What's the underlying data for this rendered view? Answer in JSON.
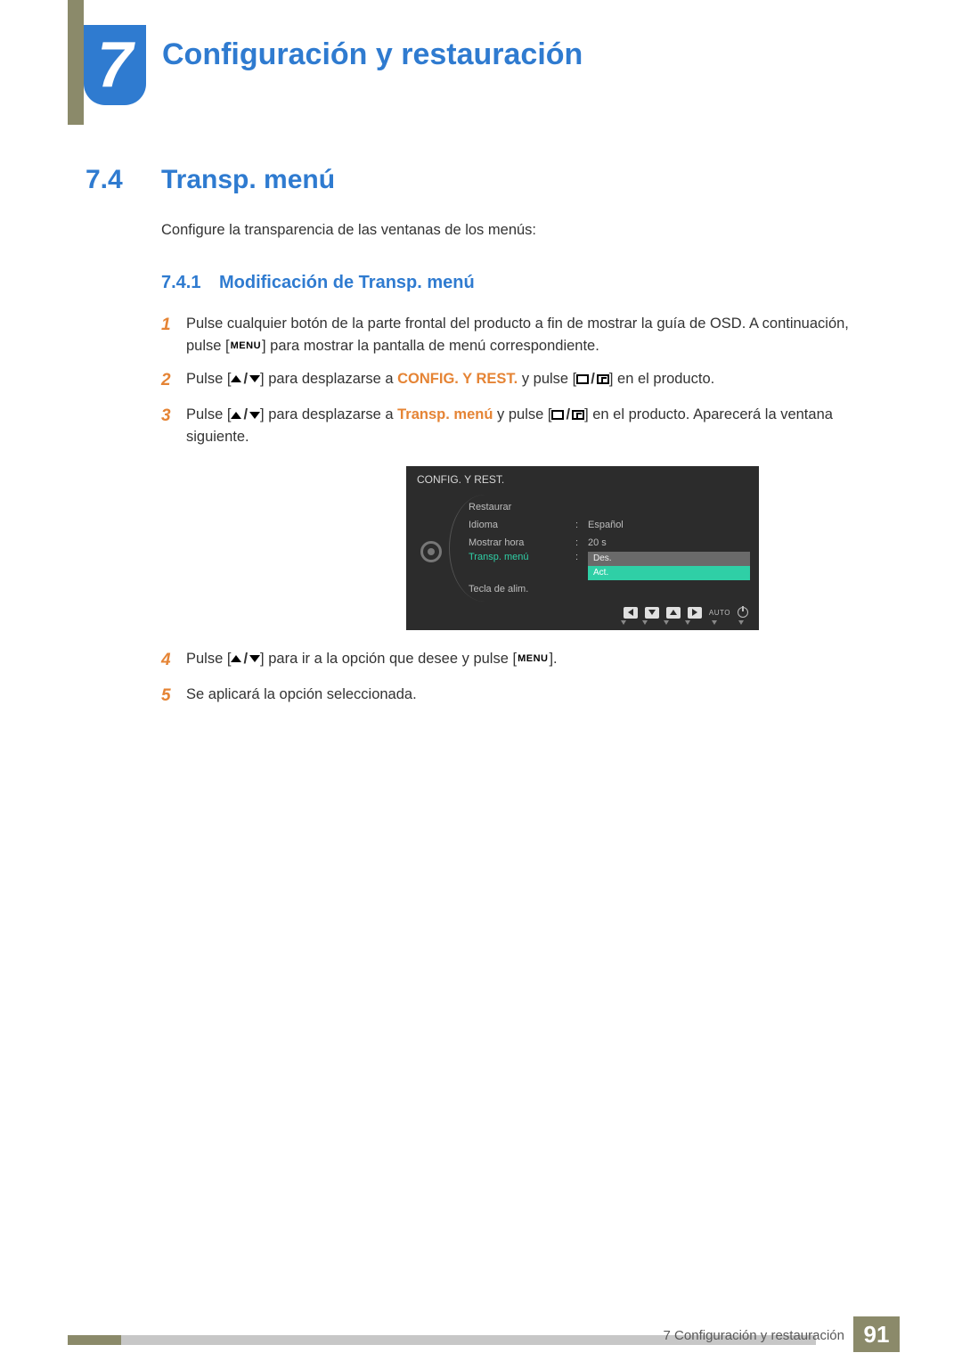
{
  "chapter": {
    "number": "7",
    "title": "Configuración y restauración"
  },
  "section": {
    "number": "7.4",
    "title": "Transp. menú"
  },
  "intro": "Configure la transparencia de las ventanas de los menús:",
  "subsection": {
    "number": "7.4.1",
    "title": "Modificación de Transp. menú"
  },
  "steps": {
    "s1": {
      "n": "1",
      "a": "Pulse cualquier botón de la parte frontal del producto a fin de mostrar la guía de OSD. A continuación, pulse [",
      "menu": "MENU",
      "b": "] para mostrar la pantalla de menú correspondiente."
    },
    "s2": {
      "n": "2",
      "a": "Pulse [",
      "b": "] para desplazarse a ",
      "strong": "CONFIG. Y REST.",
      "c": " y pulse [",
      "d": "] en el producto."
    },
    "s3": {
      "n": "3",
      "a": "Pulse [",
      "b": "] para desplazarse a ",
      "strong": "Transp. menú",
      "c": " y pulse [",
      "d": "] en el producto. Aparecerá la ventana siguiente."
    },
    "s4": {
      "n": "4",
      "a": "Pulse [",
      "b": "] para ir a la opción que desee y pulse [",
      "menu": "MENU",
      "c": "]."
    },
    "s5": {
      "n": "5",
      "a": "Se aplicará la opción seleccionada."
    }
  },
  "osd": {
    "title": "CONFIG. Y REST.",
    "rows": {
      "r1": {
        "label": "Restaurar"
      },
      "r2": {
        "label": "Idioma",
        "value": "Español"
      },
      "r3": {
        "label": "Mostrar hora",
        "value": "20 s"
      },
      "r4": {
        "label": "Transp. menú",
        "opt1": "Des.",
        "opt2": "Act."
      },
      "r5": {
        "label": "Tecla de alim."
      }
    },
    "auto": "AUTO"
  },
  "footer": {
    "text": "7 Configuración y restauración",
    "page": "91"
  }
}
